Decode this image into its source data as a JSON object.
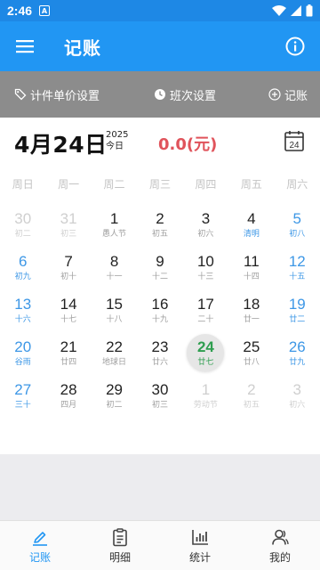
{
  "status": {
    "time": "2:46"
  },
  "app_bar": {
    "title": "记账"
  },
  "actions": {
    "piece_price": "计件单价设置",
    "shift": "班次设置",
    "record": "记账"
  },
  "header": {
    "date": "4月24日",
    "year": "2025",
    "today": "今日",
    "amount": "0.0(元)",
    "calendar_day": "24"
  },
  "weekdays": [
    "周日",
    "周一",
    "周二",
    "周三",
    "周四",
    "周五",
    "周六"
  ],
  "weeks": [
    [
      {
        "n": "30",
        "s": "初二",
        "k": "other"
      },
      {
        "n": "31",
        "s": "初三",
        "k": "other"
      },
      {
        "n": "1",
        "s": "愚人节",
        "k": ""
      },
      {
        "n": "2",
        "s": "初五",
        "k": ""
      },
      {
        "n": "3",
        "s": "初六",
        "k": ""
      },
      {
        "n": "4",
        "s": "清明",
        "k": "term"
      },
      {
        "n": "5",
        "s": "初八",
        "k": "weekend"
      }
    ],
    [
      {
        "n": "6",
        "s": "初九",
        "k": "weekend"
      },
      {
        "n": "7",
        "s": "初十",
        "k": ""
      },
      {
        "n": "8",
        "s": "十一",
        "k": ""
      },
      {
        "n": "9",
        "s": "十二",
        "k": ""
      },
      {
        "n": "10",
        "s": "十三",
        "k": ""
      },
      {
        "n": "11",
        "s": "十四",
        "k": ""
      },
      {
        "n": "12",
        "s": "十五",
        "k": "weekend"
      }
    ],
    [
      {
        "n": "13",
        "s": "十六",
        "k": "weekend"
      },
      {
        "n": "14",
        "s": "十七",
        "k": ""
      },
      {
        "n": "15",
        "s": "十八",
        "k": ""
      },
      {
        "n": "16",
        "s": "十九",
        "k": ""
      },
      {
        "n": "17",
        "s": "二十",
        "k": ""
      },
      {
        "n": "18",
        "s": "廿一",
        "k": ""
      },
      {
        "n": "19",
        "s": "廿二",
        "k": "weekend"
      }
    ],
    [
      {
        "n": "20",
        "s": "谷雨",
        "k": "weekend"
      },
      {
        "n": "21",
        "s": "廿四",
        "k": ""
      },
      {
        "n": "22",
        "s": "地球日",
        "k": ""
      },
      {
        "n": "23",
        "s": "廿六",
        "k": ""
      },
      {
        "n": "24",
        "s": "廿七",
        "k": "today"
      },
      {
        "n": "25",
        "s": "廿八",
        "k": ""
      },
      {
        "n": "26",
        "s": "廿九",
        "k": "weekend"
      }
    ],
    [
      {
        "n": "27",
        "s": "三十",
        "k": "weekend"
      },
      {
        "n": "28",
        "s": "四月",
        "k": ""
      },
      {
        "n": "29",
        "s": "初二",
        "k": ""
      },
      {
        "n": "30",
        "s": "初三",
        "k": ""
      },
      {
        "n": "1",
        "s": "劳动节",
        "k": "other"
      },
      {
        "n": "2",
        "s": "初五",
        "k": "other"
      },
      {
        "n": "3",
        "s": "初六",
        "k": "other"
      }
    ]
  ],
  "nav": [
    {
      "label": "记账",
      "icon": "pen-icon",
      "active": true
    },
    {
      "label": "明细",
      "icon": "clipboard-icon",
      "active": false
    },
    {
      "label": "统计",
      "icon": "bar-chart-icon",
      "active": false
    },
    {
      "label": "我的",
      "icon": "user-icon",
      "active": false
    }
  ],
  "colors": {
    "primary": "#2196f3",
    "action_bar": "#8c8c8c",
    "amount": "#e0535b",
    "weekend": "#3d97e6",
    "today": "#2e9e4f"
  }
}
